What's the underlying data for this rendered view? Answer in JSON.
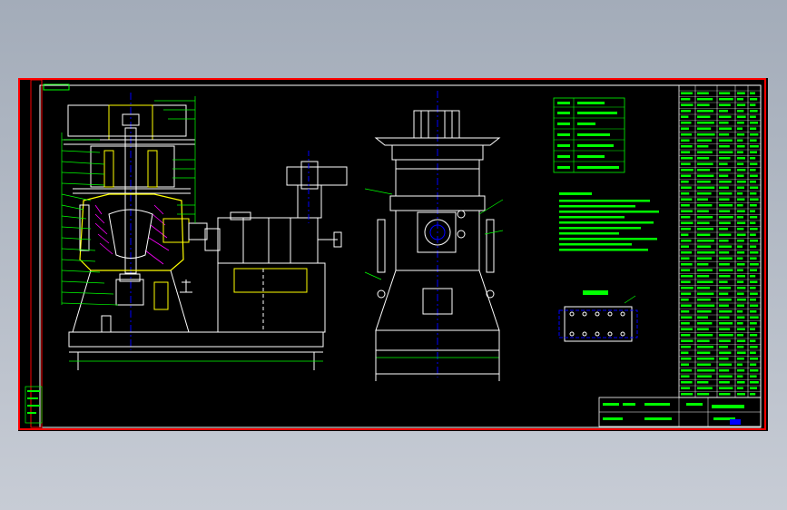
{
  "drawing": {
    "background": "#000000",
    "colors": {
      "frame": "#ff0000",
      "line": "#ffffff",
      "text": "#00ff00",
      "section": "#ffff00",
      "center": "#0000ff",
      "hatch": "#ff00ff",
      "paper": "#a8b0bd"
    }
  }
}
